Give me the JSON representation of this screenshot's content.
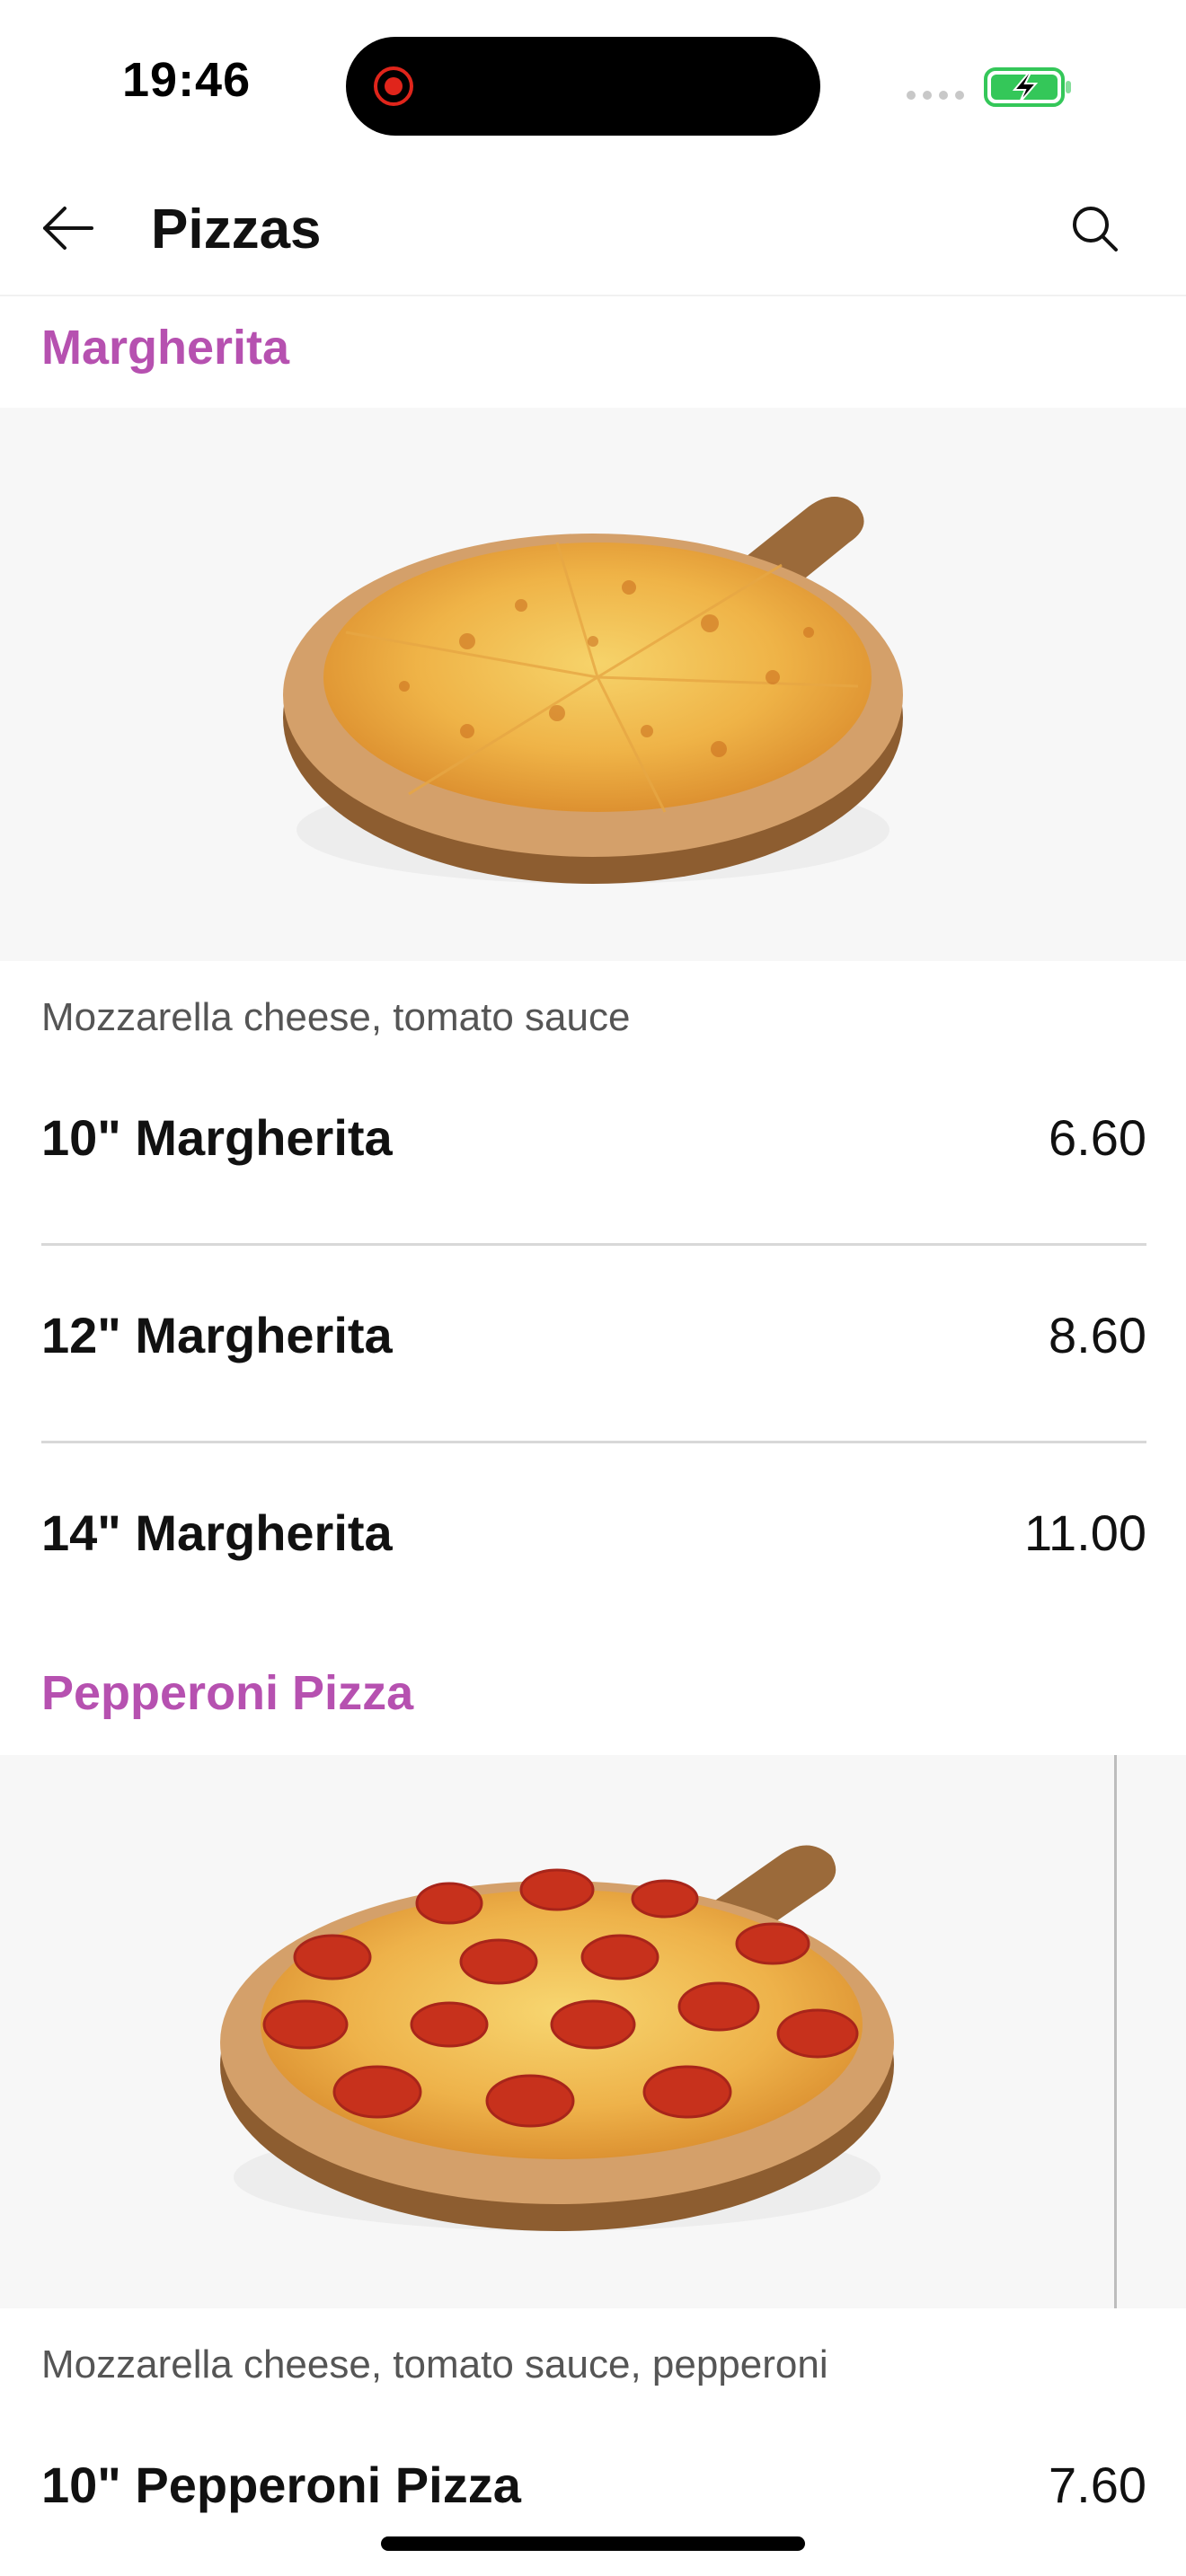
{
  "status_bar": {
    "time": "19:46",
    "record_icon": "screen-record-icon",
    "signal_icon": "cellular-signal-icon",
    "battery_icon": "battery-charging-icon",
    "battery_color": "#34c759"
  },
  "nav": {
    "title": "Pizzas",
    "back_icon": "arrow-left-icon",
    "search_icon": "search-icon"
  },
  "theme": {
    "accent": "#b651b0"
  },
  "categories": [
    {
      "title": "Margherita",
      "description": "Mozzarella cheese, tomato sauce",
      "image_icon": "margherita-pizza-image",
      "items": [
        {
          "name": "10\" Margherita",
          "price": "6.60"
        },
        {
          "name": "12\" Margherita",
          "price": "8.60"
        },
        {
          "name": "14\" Margherita",
          "price": "11.00"
        }
      ]
    },
    {
      "title": "Pepperoni Pizza",
      "description": "Mozzarella cheese, tomato sauce, pepperoni",
      "image_icon": "pepperoni-pizza-image",
      "items": [
        {
          "name": "10\" Pepperoni Pizza",
          "price": "7.60"
        }
      ]
    }
  ]
}
